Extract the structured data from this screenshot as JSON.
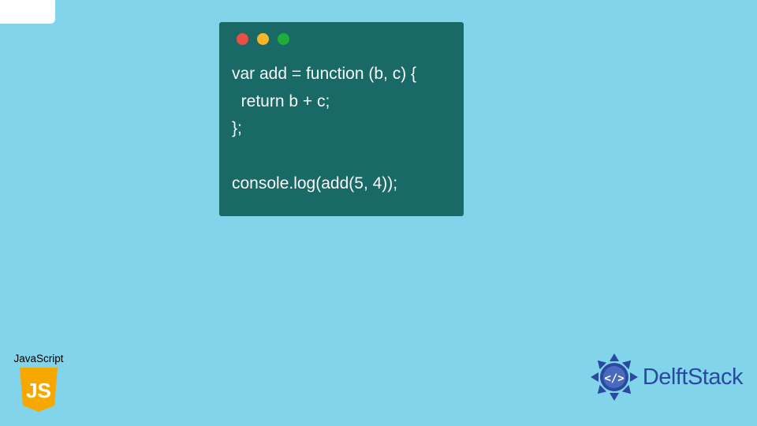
{
  "code": {
    "line1": "var add = function (b, c) {",
    "line2": "  return b + c;",
    "line3": "};",
    "line4": "",
    "line5": "console.log(add(5, 4));"
  },
  "js_badge": {
    "label": "JavaScript",
    "logo_letters": "JS"
  },
  "brand": {
    "name": "DelftStack"
  },
  "colors": {
    "bg": "#81d4ea",
    "window": "#196a66",
    "dot_red": "#e84f47",
    "dot_yellow": "#f7b62c",
    "dot_green": "#1fae3c",
    "js_yellow": "#f7a800",
    "brand_blue": "#2a4aa0"
  }
}
